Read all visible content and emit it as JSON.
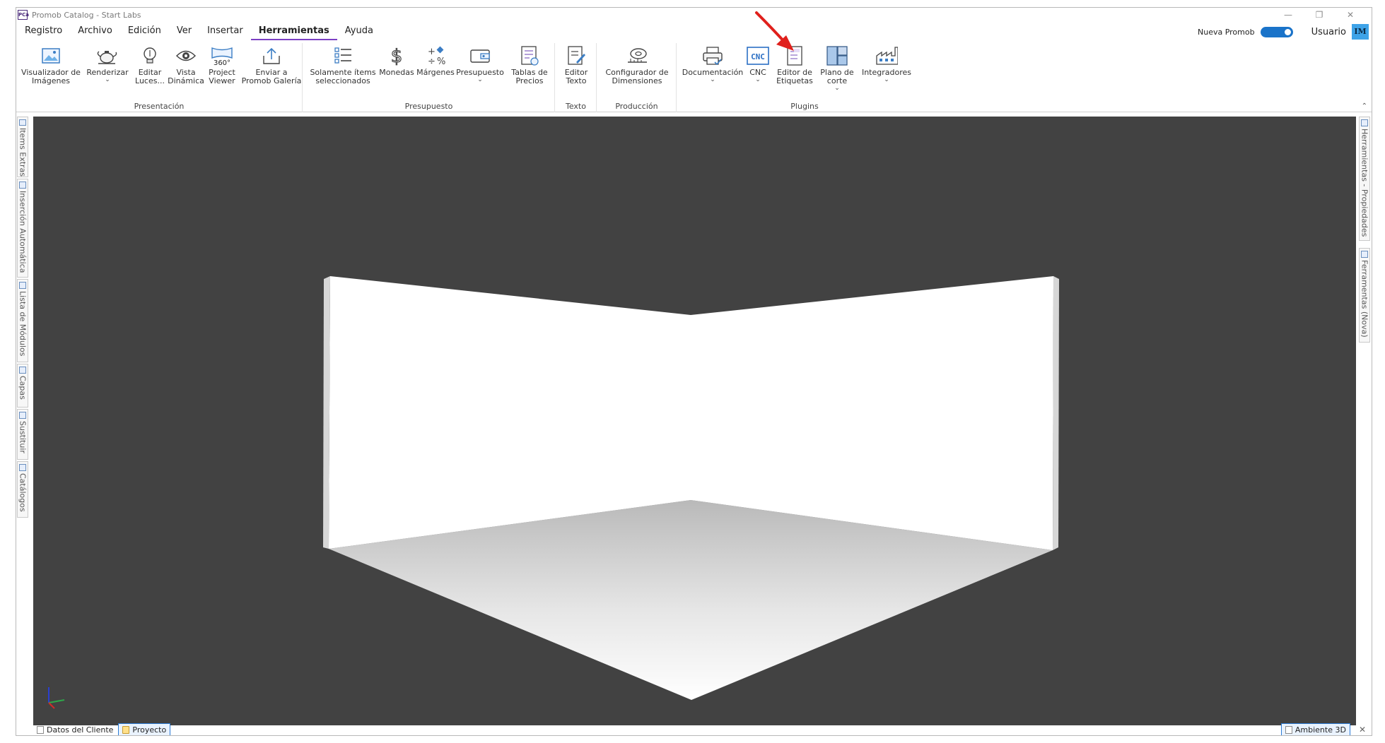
{
  "window": {
    "title": "Promob Catalog - Start Labs",
    "app_icon_text": "PCa",
    "minimize": "—",
    "restore": "❐",
    "close": "✕"
  },
  "menu": {
    "items": [
      "Registro",
      "Archivo",
      "Edición",
      "Ver",
      "Insertar",
      "Herramientas",
      "Ayuda"
    ],
    "active": "Herramientas",
    "nueva_promob": "Nueva Promob",
    "usuario": "Usuario",
    "avatar_initials": "IM"
  },
  "ribbon": {
    "groups": {
      "presentacion": "Presentación",
      "presupuesto": "Presupuesto",
      "texto": "Texto",
      "produccion": "Producción",
      "plugins": "Plugins"
    },
    "buttons": {
      "visualizador": "Visualizador de\nImágenes",
      "renderizar": "Renderizar",
      "editar_luces": "Editar\nLuces...",
      "vista_dinamica": "Vista\nDinámica",
      "project_viewer": "Project\nViewer",
      "enviar_galeria": "Enviar a\nPromob Galería",
      "solamente_items": "Solamente ítems\nseleccionados",
      "monedas": "Monedas",
      "margenes": "Márgenes",
      "presupuesto": "Presupuesto",
      "tablas_precios": "Tablas de\nPrecios",
      "editor_texto": "Editor\nTexto",
      "configurador_dimensiones": "Configurador de\nDimensiones",
      "documentacion": "Documentación",
      "cnc": "CNC",
      "editor_etiquetas": "Editor de\nEtiquetas",
      "plano_corte": "Plano de\ncorte",
      "integradores": "Integradores"
    },
    "icon_text": {
      "cnc": "CNC",
      "360": "360°"
    },
    "chevron": "⌄",
    "collapse": "⌃"
  },
  "left_tabs": [
    "Items Extras",
    "Inserción Automática",
    "Lista de Módulos",
    "Capas",
    "Sustituir",
    "Catálogos"
  ],
  "right_tabs": [
    "Herramientas - Propiedades",
    "Ferramentas (Nova)"
  ],
  "status": {
    "datos_cliente": "Datos del Cliente",
    "proyecto": "Proyecto",
    "ambiente_3d": "Ambiente 3D",
    "close": "✕"
  },
  "colors": {
    "accent": "#7b3fc4",
    "toggle": "#1a73c9",
    "viewport_bg": "#424242",
    "annotation_arrow": "#e0201c"
  }
}
